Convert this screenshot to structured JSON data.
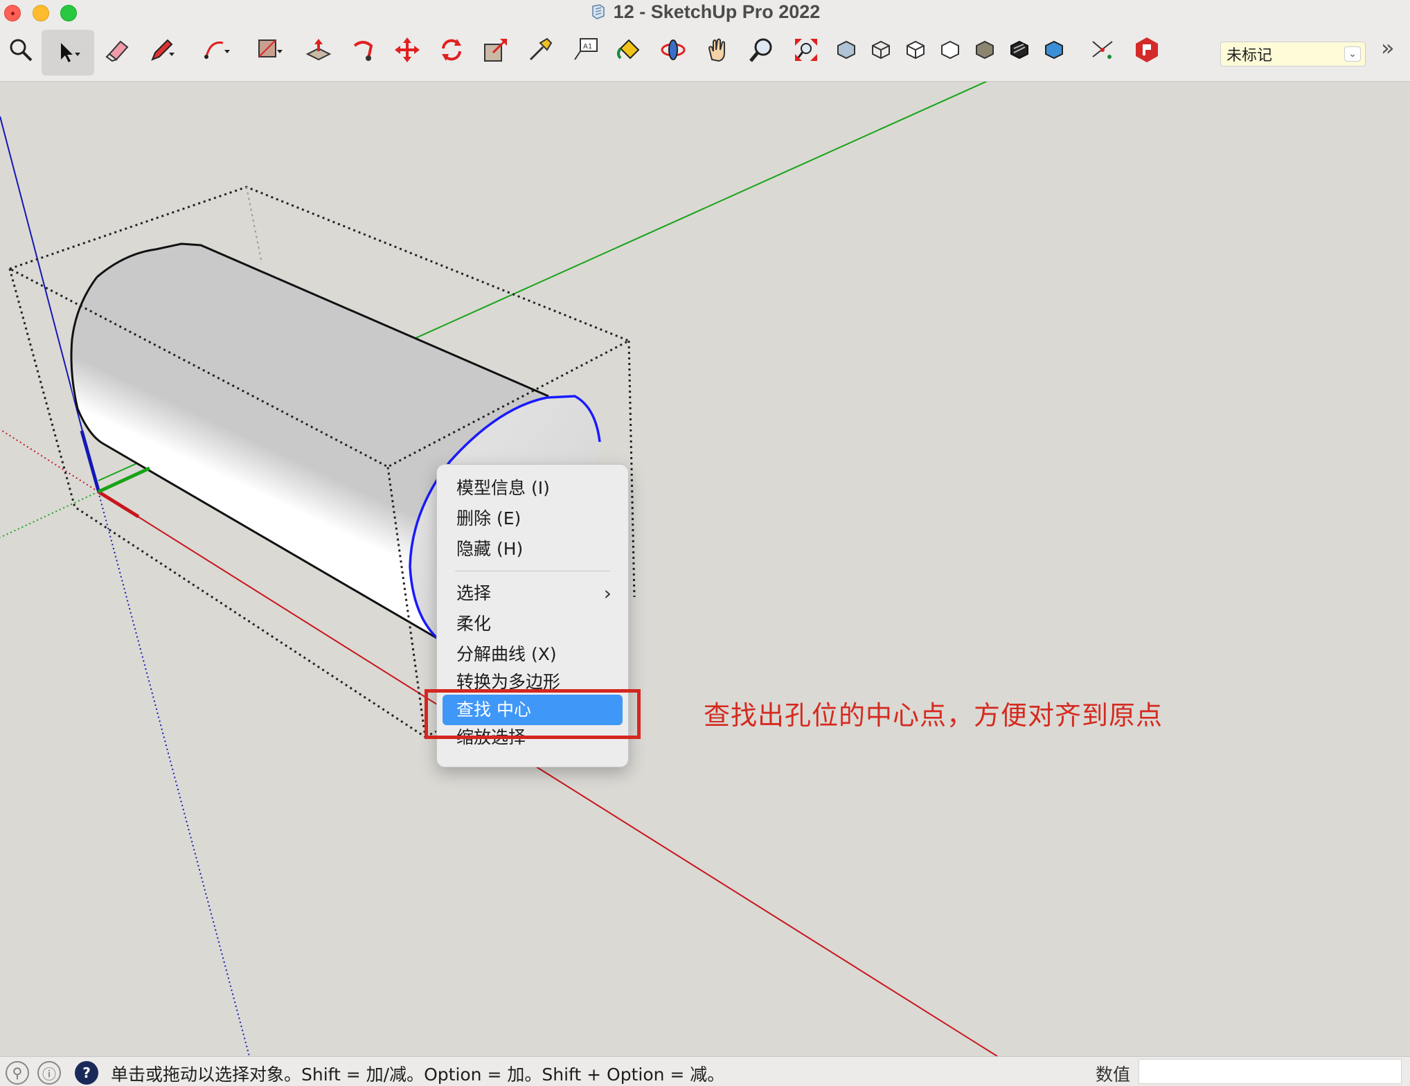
{
  "window": {
    "title": "12 - SketchUp Pro 2022"
  },
  "toolbar": {
    "tools": [
      "zoom-extents-icon",
      "select-icon",
      "eraser-icon",
      "pencil-icon",
      "arc-icon",
      "rectangle-icon",
      "push-pull-icon",
      "follow-me-icon",
      "move-icon",
      "rotate-icon",
      "scale-icon",
      "tape-measure-icon",
      "text-icon",
      "paint-bucket-icon",
      "orbit-icon",
      "pan-icon",
      "zoom-icon",
      "zoom-window-icon",
      "xray-icon",
      "wireframe-icon",
      "hidden-line-icon",
      "back-edges-icon",
      "shaded-icon",
      "shaded-texture-icon",
      "monochrome-icon",
      "sandbox-icon",
      "extension-warehouse-icon"
    ],
    "tag_select": "未标记"
  },
  "context_menu": {
    "items": [
      {
        "label": "模型信息 (I)"
      },
      {
        "label": "删除 (E)"
      },
      {
        "label": "隐藏 (H)"
      },
      {
        "label": "选择"
      },
      {
        "label": "柔化"
      },
      {
        "label": "分解曲线 (X)"
      },
      {
        "label": "转换为多边形"
      },
      {
        "label": "查找 中心"
      },
      {
        "label": "缩放选择"
      }
    ],
    "highlighted": "查找 中心"
  },
  "annotation": {
    "text": "查找出孔位的中心点，方便对齐到原点",
    "color": "#d52a20"
  },
  "statusbar": {
    "hint": "单击或拖动以选择对象。Shift = 加/减。Option = 加。Shift + Option = 减。",
    "measurements_label": "数值",
    "measurements_value": ""
  },
  "colors": {
    "x_axis": "#c8161d",
    "y_axis": "#18a318",
    "z_axis": "#1418b4",
    "selection": "#1a1aff",
    "menu_highlight": "#3f97f8"
  }
}
